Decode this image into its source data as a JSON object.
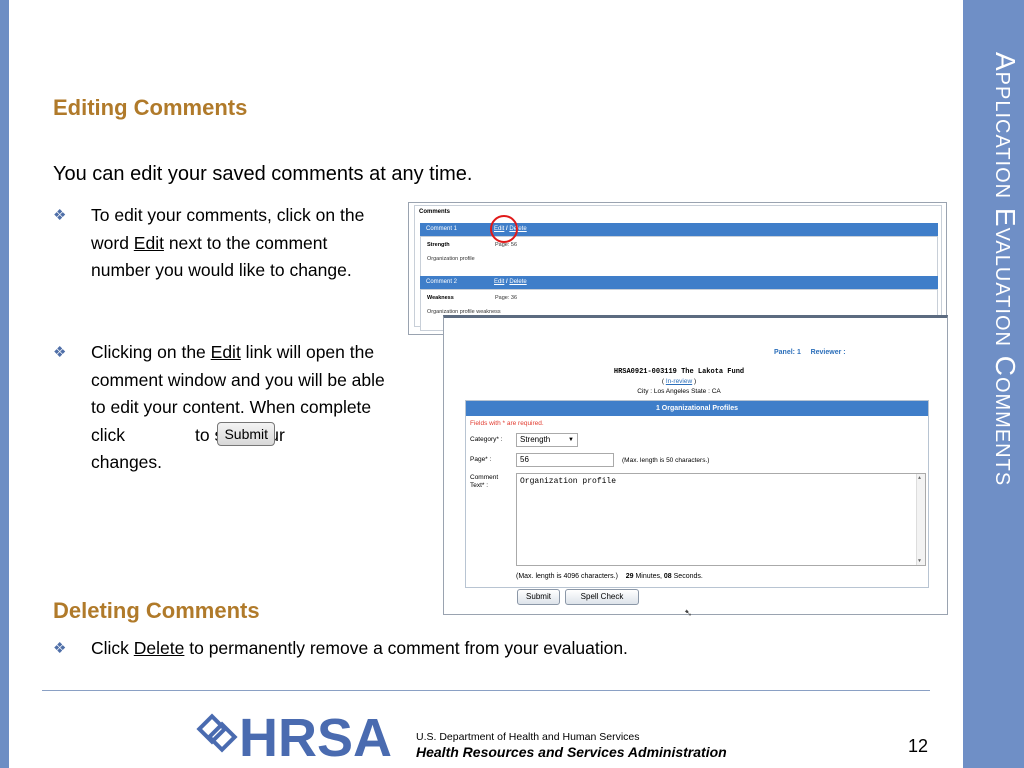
{
  "slide": {
    "vertical_title": "Application Evaluation Comments",
    "editing_heading": "Editing Comments",
    "intro": "You can edit your saved comments at any time.",
    "bullet1": {
      "pre": "To edit your comments, click on the word ",
      "link": "Edit",
      "post": " next to the comment number you would like to change."
    },
    "bullet2": {
      "pre": "Clicking on the ",
      "link": "Edit",
      "mid": " link will open the comment window and you will be able to edit your content.  When complete click",
      "submit": "Submit",
      "to_s": "to s",
      "ur": "ur",
      "end": "changes."
    },
    "deleting_heading": "Deleting Comments",
    "bullet3": {
      "pre": "Click ",
      "link": "Delete",
      "post": " to permanently remove a comment from your evaluation."
    },
    "page_number": "12",
    "bullet_glyph": "❖"
  },
  "comments_screenshot": {
    "label": "Comments",
    "items": [
      {
        "title": "Comment 1",
        "edit": "Edit",
        "sep": "/",
        "delete": "Delete",
        "key": "Strength",
        "page": "Page: 56",
        "text": "Organization profile"
      },
      {
        "title": "Comment 2",
        "edit": "Edit",
        "sep": "/",
        "delete": "Delete",
        "key": "Weakness",
        "page": "Page: 36",
        "text": "Organization profile weakness"
      }
    ]
  },
  "edit_screenshot": {
    "panel": "Panel: 1",
    "reviewer": "Reviewer :",
    "grantee": "HRSA0921-003119 The Lakota Fund",
    "status_open": "(",
    "status": "In-review",
    "status_close": ")",
    "city": "City :  Los Angeles        State :  CA",
    "form_title": "1 Organizational Profiles",
    "required_note": "Fields with * are required.",
    "category_label": "Category* :",
    "category_value": "Strength",
    "page_label": "Page* :",
    "page_value": "56",
    "page_hint": "(Max. length is 50 characters.)",
    "comment_label": "Comment Text* :",
    "comment_value": "Organization profile",
    "max_text": "(Max. length is 4096 characters.)",
    "minutes": "29",
    "minutes_label": "Minutes,",
    "seconds": "08",
    "seconds_label": "Seconds.",
    "submit_label": "Submit",
    "spell_label": "Spell Check"
  },
  "footer": {
    "logo_text": "HRSA",
    "dept": "U.S. Department of Health and Human Services",
    "agency": "Health Resources and Services Administration"
  },
  "colors": {
    "accent_band": "#6f8fc6",
    "heading": "#b07a2a",
    "logo_blue": "#4a6bb0"
  }
}
